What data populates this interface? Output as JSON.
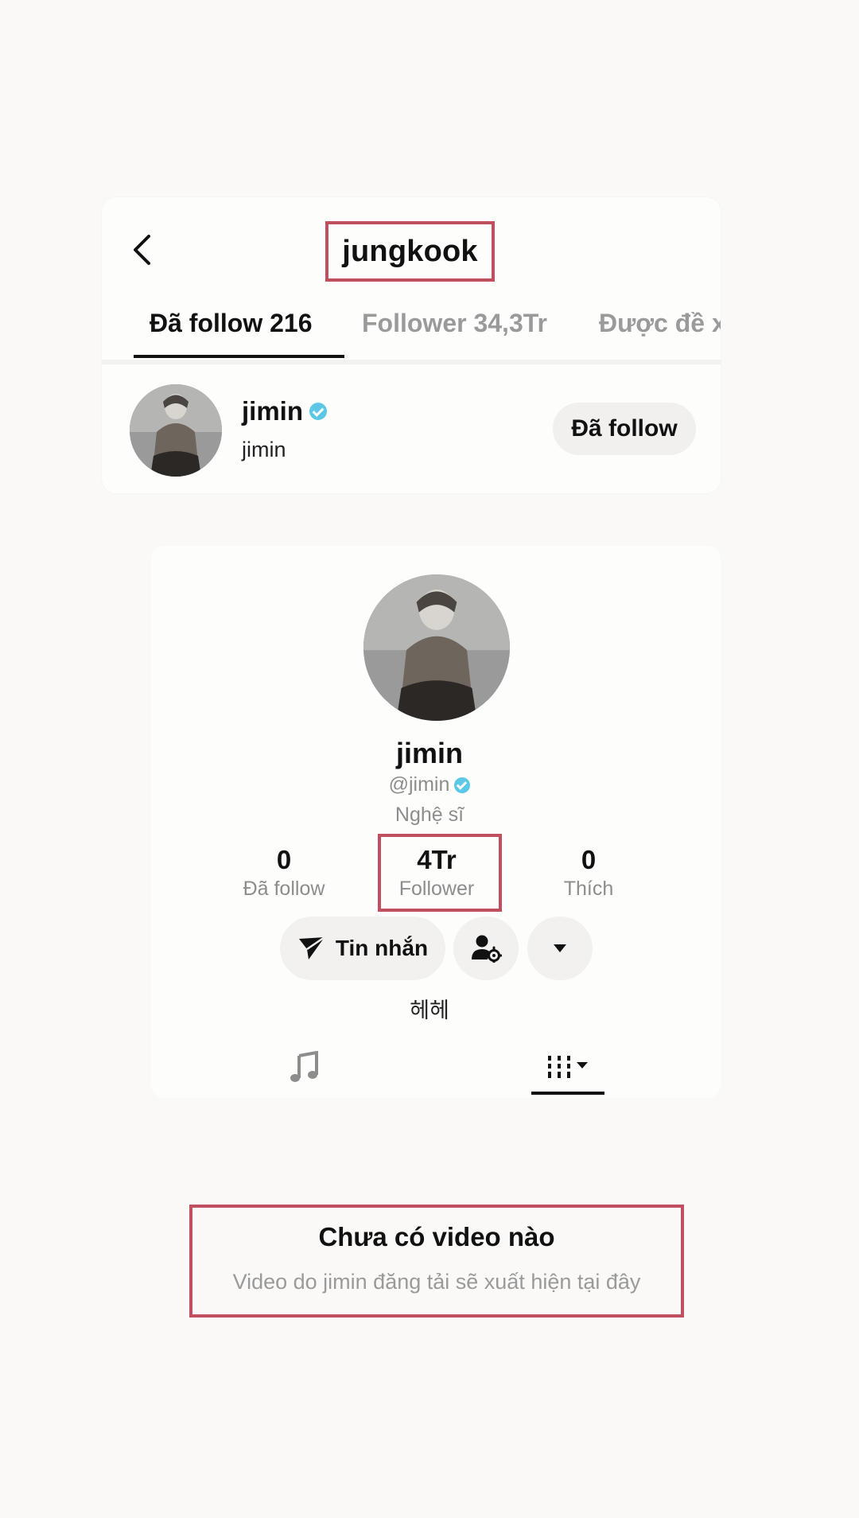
{
  "header": {
    "title": "jungkook",
    "back_icon": "chevron-left-icon"
  },
  "tabs": [
    {
      "label": "Đã follow 216",
      "active": true
    },
    {
      "label": "Follower 34,3Tr",
      "active": false
    },
    {
      "label": "Được đề x",
      "active": false
    }
  ],
  "following_list": [
    {
      "name": "jimin",
      "handle": "jimin",
      "verified": true,
      "button_label": "Đã follow"
    }
  ],
  "profile": {
    "name": "jimin",
    "handle": "@jimin",
    "verified": true,
    "role": "Nghệ sĩ",
    "stats": [
      {
        "value": "0",
        "label": "Đã follow"
      },
      {
        "value": "4Tr",
        "label": "Follower"
      },
      {
        "value": "0",
        "label": "Thích"
      }
    ],
    "message_button": "Tin nhắn",
    "bio": "헤헤"
  },
  "empty_state": {
    "title": "Chưa có video nào",
    "subtitle": "Video do jimin đăng tải sẽ xuất hiện tại đây"
  },
  "colors": {
    "highlight": "#c0505f",
    "verified": "#5cc8e6",
    "muted_text": "#8d8d8d"
  }
}
